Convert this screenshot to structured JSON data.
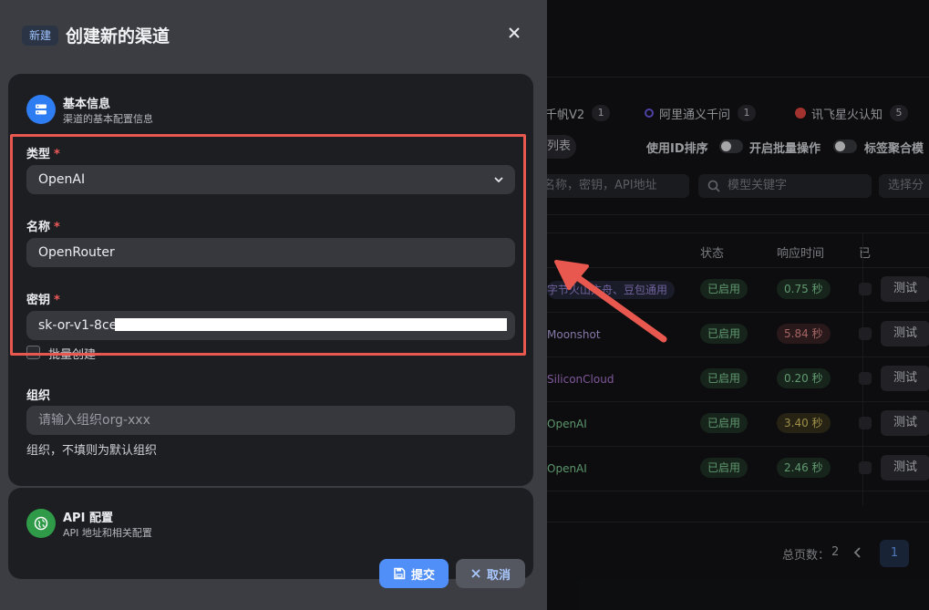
{
  "drawer": {
    "badge": "新建",
    "title": "创建新的渠道",
    "card_basic": {
      "title": "基本信息",
      "subtitle": "渠道的基本配置信息"
    },
    "fields": {
      "type": {
        "label": "类型",
        "required": "*",
        "value": "OpenAI"
      },
      "name": {
        "label": "名称",
        "required": "*",
        "value": "OpenRouter"
      },
      "key": {
        "label": "密钥",
        "required": "*",
        "value": "sk-or-v1-8ce"
      },
      "batch": {
        "label": "批量创建"
      },
      "org": {
        "label": "组织",
        "placeholder": "请输入组织org-xxx",
        "hint": "组织，不填则为默认组织"
      }
    },
    "card_api": {
      "title": "API 配置",
      "subtitle": "API 地址和相关配置"
    },
    "buttons": {
      "submit": "提交",
      "cancel": "取消"
    }
  },
  "background": {
    "tabs": [
      {
        "label": "千帆V2",
        "count": "1"
      },
      {
        "label": "阿里通义千问",
        "count": "1"
      },
      {
        "label": "讯飞星火认知",
        "count": "5"
      }
    ],
    "list_chip": "列表",
    "toggles": [
      {
        "label": "使用ID排序"
      },
      {
        "label": "开启批量操作"
      },
      {
        "label": "标签聚合模"
      }
    ],
    "search": {
      "name_placeholder": "名称，密钥，API地址",
      "model_placeholder": "模型关键字",
      "group_placeholder": "选择分"
    },
    "table": {
      "headers": {
        "status": "状态",
        "response_time": "响应时间",
        "balance": "已"
      },
      "rows": [
        {
          "name": "字节火山方舟、豆包通用",
          "status": "已启用",
          "time": "0.75 秒",
          "time_level": "green",
          "action": "测试"
        },
        {
          "name": "Moonshot",
          "status": "已启用",
          "time": "5.84 秒",
          "time_level": "red",
          "action": "测试"
        },
        {
          "name": "SiliconCloud",
          "status": "已启用",
          "time": "0.20 秒",
          "time_level": "green",
          "action": "测试"
        },
        {
          "name": "OpenAI",
          "status": "已启用",
          "time": "3.40 秒",
          "time_level": "yellow",
          "action": "测试"
        },
        {
          "name": "OpenAI",
          "status": "已启用",
          "time": "2.46 秒",
          "time_level": "green",
          "action": "测试"
        }
      ]
    },
    "pager": {
      "total_label": "总页数：",
      "total": "2",
      "current": "1"
    }
  },
  "colors": {
    "accent": "#4f8ff7",
    "highlight": "#e8584f",
    "required": "#ef5a5a"
  }
}
